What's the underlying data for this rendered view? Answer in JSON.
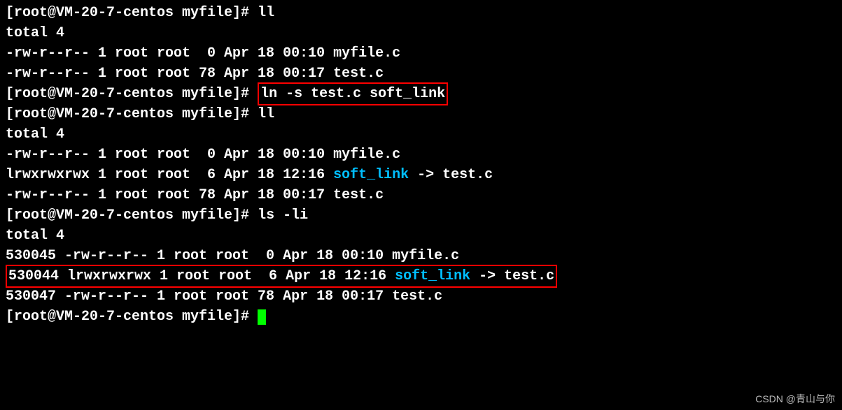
{
  "prompt": "[root@VM-20-7-centos myfile]# ",
  "commands": {
    "ll1": "ll",
    "ln": "ln -s test.c soft_link",
    "ll2": "ll",
    "lsli": "ls -li"
  },
  "total": "total 4",
  "listing1": {
    "myfile": "-rw-r--r-- 1 root root  0 Apr 18 00:10 myfile.c",
    "test": "-rw-r--r-- 1 root root 78 Apr 18 00:17 test.c"
  },
  "listing2": {
    "myfile": "-rw-r--r-- 1 root root  0 Apr 18 00:10 myfile.c",
    "softlink_pre": "lrwxrwxrwx 1 root root  6 Apr 18 12:16 ",
    "softlink_name": "soft_link",
    "softlink_post": " -> test.c",
    "test": "-rw-r--r-- 1 root root 78 Apr 18 00:17 test.c"
  },
  "listing3": {
    "myfile": "530045 -rw-r--r-- 1 root root  0 Apr 18 00:10 myfile.c",
    "softlink_pre": "530044 lrwxrwxrwx 1 root root  6 Apr 18 12:16 ",
    "softlink_name": "soft_link",
    "softlink_post": " -> test.c",
    "test": "530047 -rw-r--r-- 1 root root 78 Apr 18 00:17 test.c"
  },
  "watermark": "CSDN @青山与你"
}
